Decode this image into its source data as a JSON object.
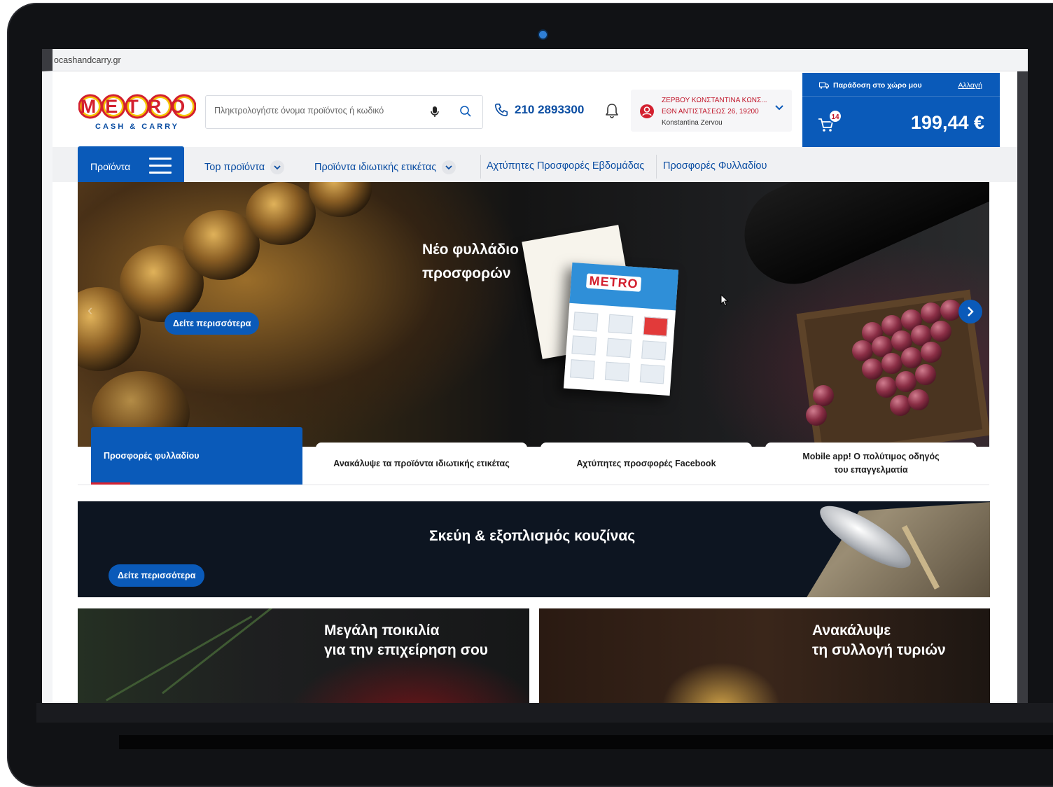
{
  "browser": {
    "url": "ocashandcarry.gr"
  },
  "header": {
    "logo_text": "METRO",
    "logo_subtext": "CASH & CARRY",
    "search_placeholder": "Πληκτρολογήστε όνομα προϊόντος ή κωδικό",
    "phone": "210 2893300",
    "account": {
      "name": "ΖΕΡΒΟΥ ΚΩΝΣΤΑΝΤΙΝΑ ΚΩΝΣ...",
      "address": "ΕΘΝ ΑΝΤΙΣΤΑΣΕΩΣ 26, 19200",
      "user": "Konstantina Zervou"
    },
    "cart": {
      "delivery_label": "Παράδοση στο χώρο μου",
      "change_label": "Αλλαγή",
      "count": "14",
      "total": "199,44 €"
    }
  },
  "nav": {
    "products_label": "Προϊόντα",
    "items": [
      {
        "label": "Top προϊόντα"
      },
      {
        "label": "Προϊόντα ιδιωτικής ετικέτας"
      },
      {
        "label": "Αχτύπητες Προσφορές Εβδομάδας"
      },
      {
        "label": "Προσφορές Φυλλαδίου"
      }
    ]
  },
  "hero": {
    "title_line1": "Νέο φυλλάδιο",
    "title_line2": "προσφορών",
    "button": "Δείτε περισσότερα",
    "brochure_logo": "METRO"
  },
  "tabs": [
    {
      "label": "Προσφορές φυλλαδίου",
      "active": true
    },
    {
      "label": "Ανακάλυψε τα προϊόντα ιδιωτικής ετικέτας"
    },
    {
      "label": "Αχτύπητες προσφορές Facebook"
    },
    {
      "label": "Mobile app! Ο πολύτιμος οδηγός του επαγγελματία"
    }
  ],
  "banner": {
    "title": "Σκεύη & εξοπλισμός κουζίνας",
    "button": "Δείτε περισσότερα"
  },
  "cards": [
    {
      "line1": "Μεγάλη ποικιλία",
      "line2": "για την επιχείρηση σου"
    },
    {
      "line1": "Ανακάλυψε",
      "line2": "τη συλλογή τυριών"
    }
  ],
  "colors": {
    "brand_blue": "#0a5ab9",
    "brand_red": "#d3202f",
    "brand_yellow": "#f5c400"
  }
}
